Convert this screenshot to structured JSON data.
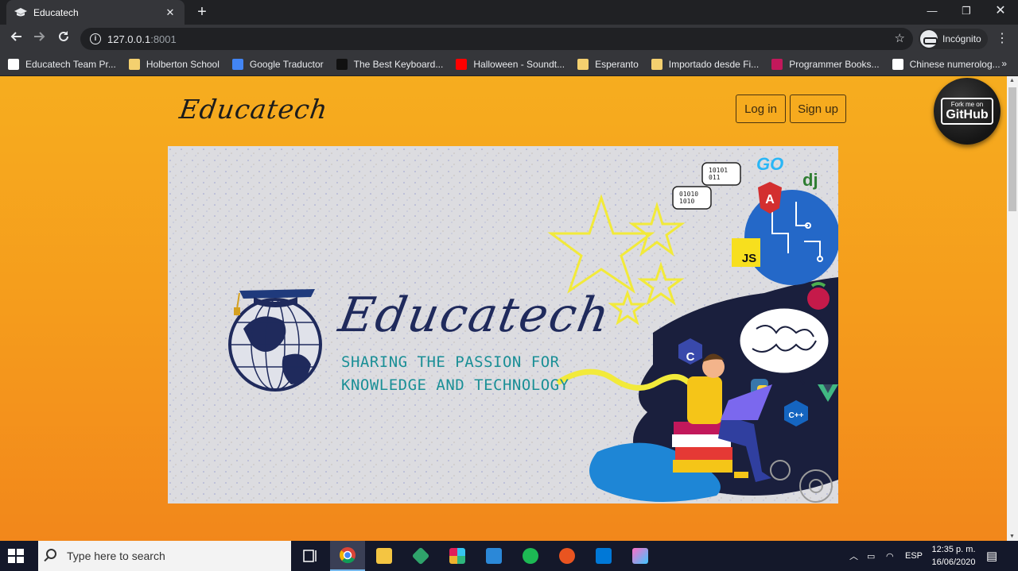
{
  "browser": {
    "tab_title": "Educatech",
    "tab_close": "✕",
    "new_tab": "+",
    "url_host": "127.0.0.1",
    "url_port": ":8001",
    "incognito_label": "Incógnito",
    "bookmarks": [
      {
        "label": "Educatech Team Pr...",
        "icon": "trello-icon",
        "color": "#ffffff"
      },
      {
        "label": "Holberton School",
        "icon": "folder-icon",
        "color": "#f4d06f"
      },
      {
        "label": "Google Traductor",
        "icon": "google-translate-icon",
        "color": "#4285f4"
      },
      {
        "label": "The Best Keyboard...",
        "icon": "htg-icon",
        "color": "#111111"
      },
      {
        "label": "Halloween - Soundt...",
        "icon": "youtube-icon",
        "color": "#ff0000"
      },
      {
        "label": "Esperanto",
        "icon": "folder-icon",
        "color": "#f4d06f"
      },
      {
        "label": "Importado desde Fi...",
        "icon": "folder-icon",
        "color": "#f4d06f"
      },
      {
        "label": "Programmer Books...",
        "icon": "programmer-books-icon",
        "color": "#c2185b"
      },
      {
        "label": "Chinese numerolog...",
        "icon": "wikipedia-icon",
        "color": "#ffffff"
      }
    ],
    "bookmarks_more": "»"
  },
  "page": {
    "logo": "Educatech",
    "login_label": "Log in",
    "signup_label": "Sign up",
    "github_small": "Fork me on",
    "github_big": "GitHub",
    "hero": {
      "title": "Educatech",
      "subtitle_line1": "SHARING THE PASSION FOR",
      "subtitle_line2": "KNOWLEDGE AND TECHNOLOGY",
      "badges": [
        "GO",
        "dj",
        "JS",
        "C",
        "C++"
      ],
      "binary_1": "10101\n011",
      "binary_2": "01010\n1010"
    },
    "colors": {
      "background_top": "#f6ad1f",
      "background_bottom": "#f2871b",
      "hero_title": "#1f2a5c",
      "hero_subtitle": "#1a8f96"
    }
  },
  "taskbar": {
    "search_placeholder": "Type here to search",
    "language": "ESP",
    "time": "12:35 p. m.",
    "date": "16/06/2020"
  }
}
